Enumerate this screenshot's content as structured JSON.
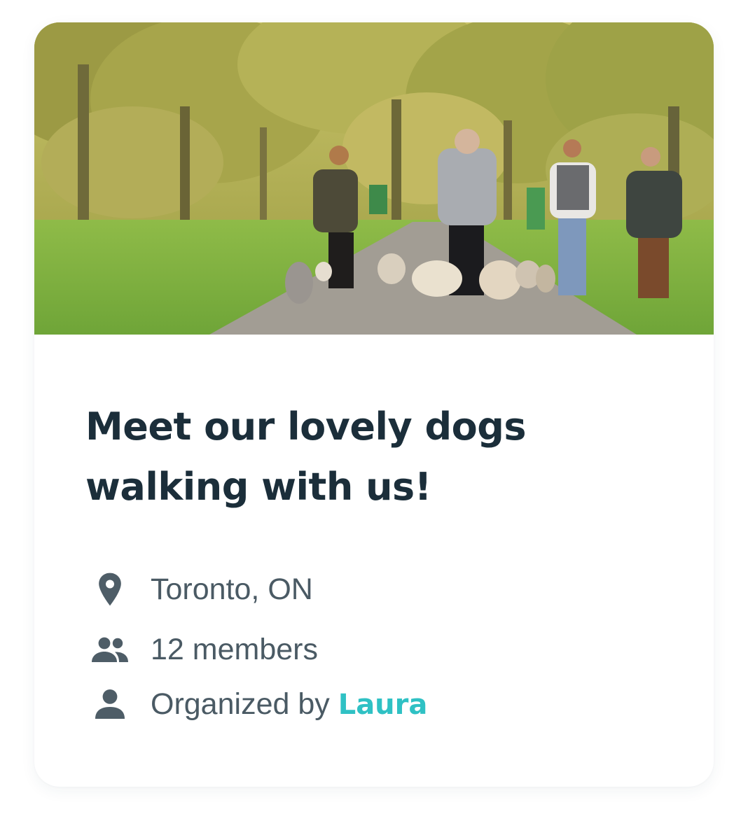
{
  "card": {
    "image_alt": "People walking dogs on a park path",
    "title": "Meet our lovely dogs walking with us!",
    "location": "Toronto, ON",
    "members": "12 members",
    "organizer_prefix": "Organized by ",
    "organizer_name": "Laura"
  },
  "icons": {
    "location": "map-pin-icon",
    "members": "group-icon",
    "organizer": "person-icon"
  },
  "colors": {
    "title": "#1b2e3a",
    "text": "#4a5a64",
    "icon": "#4e5d67",
    "accent": "#2fc1c4"
  }
}
